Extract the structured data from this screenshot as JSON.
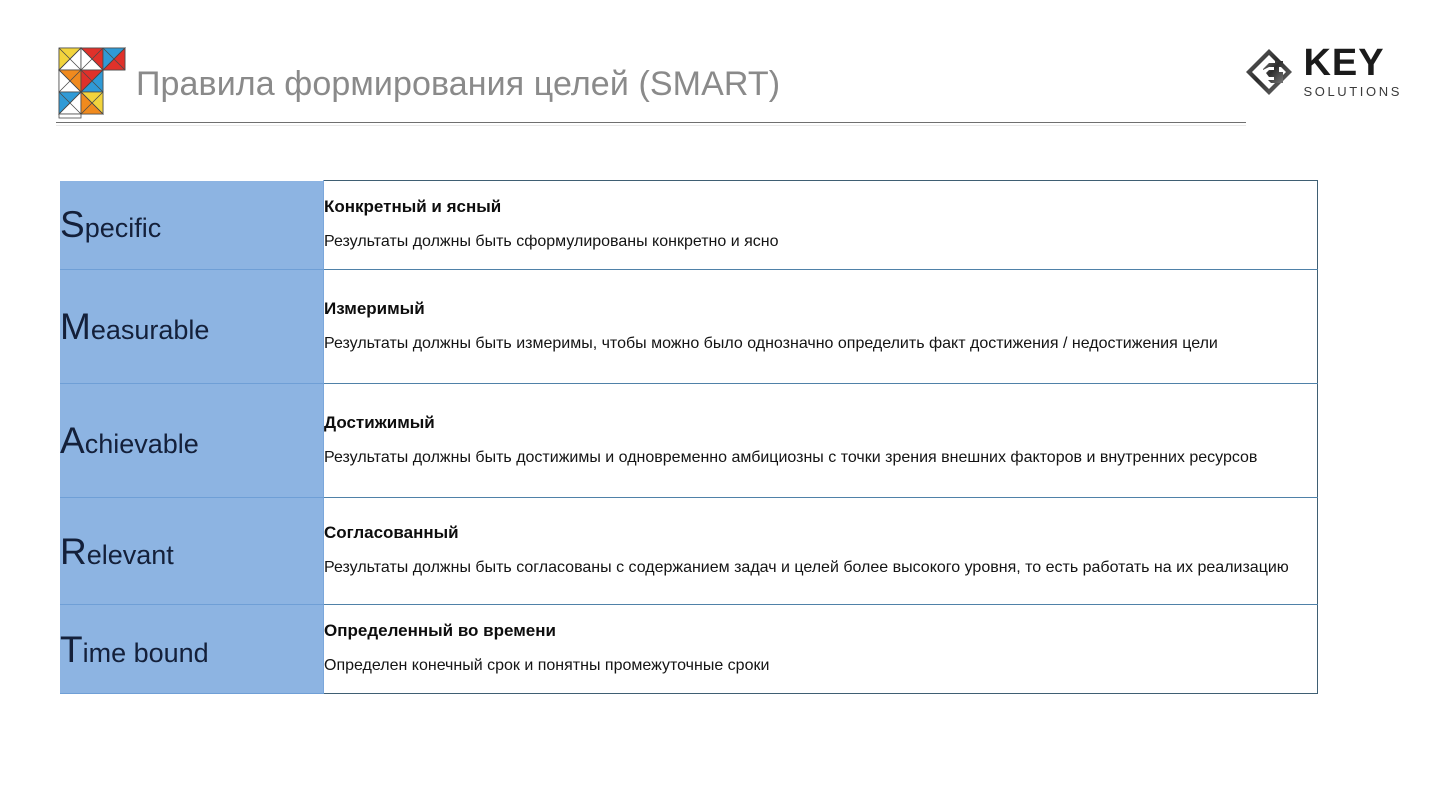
{
  "header": {
    "title": "Правила формирования целей (SMART)",
    "brand_mark_name": "tangram-logo-icon",
    "corp_logo": {
      "mark_name": "key-solutions-monogram-icon",
      "name": "KEY",
      "tagline": "SOLUTIONS"
    }
  },
  "colors": {
    "letter_cell_bg": "#8db4e2",
    "title_text": "#8a8a8a",
    "table_border": "#3f5f73",
    "body_text": "#141414"
  },
  "table": {
    "rows": [
      {
        "letter": "S",
        "rest": "pecific",
        "title": "Конкретный и ясный",
        "desc": "Результаты должны быть сформулированы конкретно и ясно"
      },
      {
        "letter": "M",
        "rest": "easurable",
        "title": "Измеримый",
        "desc": "Результаты должны быть измеримы, чтобы можно было однозначно определить факт достижения / недостижения цели"
      },
      {
        "letter": "A",
        "rest": "chievable",
        "title": "Достижимый",
        "desc": "Результаты должны быть достижимы и одновременно амбициозны с точки зрения внешних факторов и внутренних ресурсов"
      },
      {
        "letter": "R",
        "rest": "elevant",
        "title": "Согласованный",
        "desc": "Результаты должны быть согласованы с содержанием задач и целей более высокого уровня, то есть работать на их реализацию"
      },
      {
        "letter": "T",
        "rest": "ime bound",
        "title": "Определенный во времени",
        "desc": "Определен конечный срок и понятны промежуточные сроки"
      }
    ]
  }
}
